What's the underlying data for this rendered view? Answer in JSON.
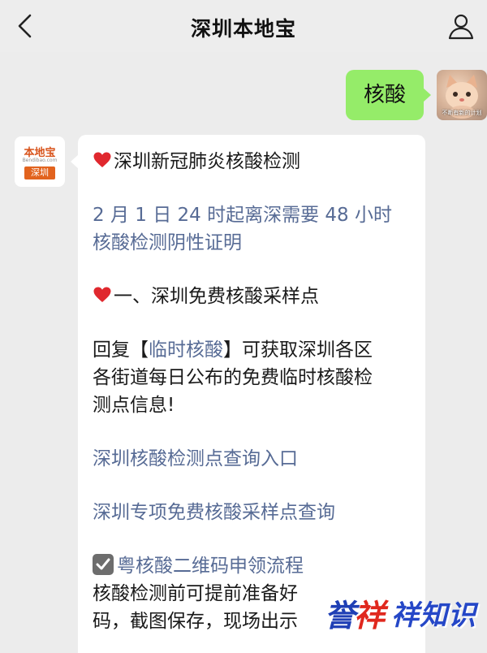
{
  "header": {
    "title": "深圳本地宝",
    "back_icon": "chevron-left-icon",
    "profile_icon": "person-icon"
  },
  "outgoing": {
    "text": "核酸",
    "avatar_caption": "不断有新的计划"
  },
  "incoming_avatar": {
    "logo_text": "本地宝",
    "logo_sub": "Bendibao.com",
    "logo_city": "深圳"
  },
  "message": {
    "heading1": "深圳新冠肺炎核酸检测",
    "notice_line1": "2 月 1 日 24 时起离深需要 48 小时",
    "notice_line2": "核酸检测阴性证明",
    "heading2": "一、深圳免费核酸采样点",
    "reply_prefix": "回复【",
    "reply_keyword": "临时核酸",
    "reply_suffix": "】可获取深圳各区",
    "reply_line2": "各街道每日公布的免费临时核酸检",
    "reply_line3": "测点信息!",
    "link1": "深圳核酸检测点查询入口",
    "link2": "深圳专项免费核酸采样点查询",
    "heading3": "粤核酸二维码申领流程",
    "body_line1": "核酸检测前可提前准备好",
    "body_line2": "码，截图保存，现场出示"
  },
  "watermark": {
    "mark": "誉",
    "mark2": "祥",
    "text": "祥知识"
  },
  "colors": {
    "link": "#576b95",
    "out_bubble": "#95ec69",
    "heart": "#e0282e"
  }
}
